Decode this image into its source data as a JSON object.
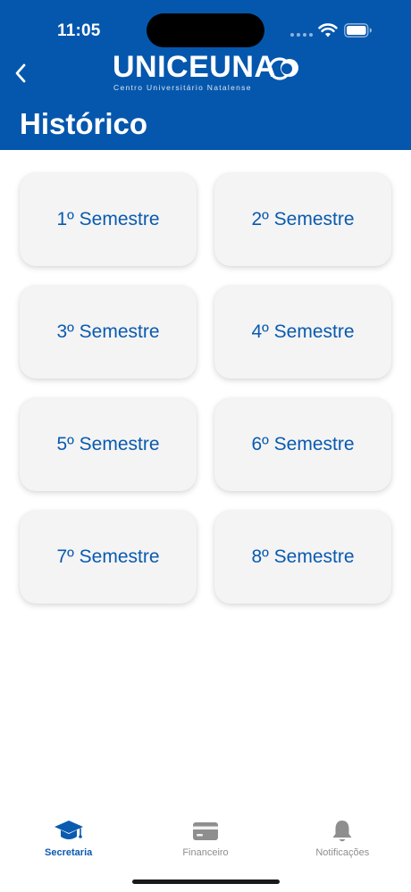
{
  "status": {
    "time": "11:05",
    "wifi_icon": "wifi-icon",
    "battery_icon": "battery-icon"
  },
  "header": {
    "back_icon": "chevron-left-icon",
    "logo": {
      "name": "UNICEUNA",
      "subtitle": "Centro Universitário Natalense"
    },
    "title": "Histórico",
    "color": "#0557ad"
  },
  "semesters": [
    {
      "label": "1º Semestre"
    },
    {
      "label": "2º Semestre"
    },
    {
      "label": "3º Semestre"
    },
    {
      "label": "4º Semestre"
    },
    {
      "label": "5º Semestre"
    },
    {
      "label": "6º Semestre"
    },
    {
      "label": "7º Semestre"
    },
    {
      "label": "8º Semestre"
    }
  ],
  "tabbar": {
    "active_color": "#0a5ab0",
    "inactive_color": "#8e8e8e",
    "items": [
      {
        "label": "Secretaria",
        "icon": "graduation-cap-icon",
        "active": true
      },
      {
        "label": "Financeiro",
        "icon": "credit-card-icon",
        "active": false
      },
      {
        "label": "Notificações",
        "icon": "bell-icon",
        "active": false
      }
    ]
  }
}
